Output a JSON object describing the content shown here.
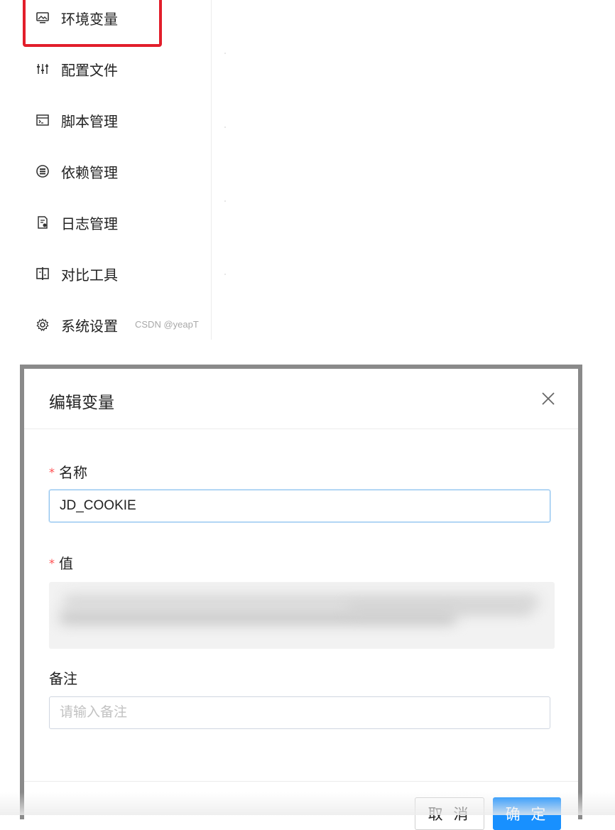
{
  "sidebar": {
    "items": [
      {
        "label": "环境变量",
        "icon": "monitor-icon"
      },
      {
        "label": "配置文件",
        "icon": "sliders-icon"
      },
      {
        "label": "脚本管理",
        "icon": "script-icon"
      },
      {
        "label": "依赖管理",
        "icon": "database-icon"
      },
      {
        "label": "日志管理",
        "icon": "log-icon"
      },
      {
        "label": "对比工具",
        "icon": "diff-icon"
      },
      {
        "label": "系统设置",
        "icon": "gear-icon"
      }
    ],
    "highlight_color": "#e21e2b"
  },
  "watermark": "CSDN @yeapT",
  "modal": {
    "title": "编辑变量",
    "close_icon": "close-icon",
    "fields": {
      "name": {
        "label": "名称",
        "required_mark": "*",
        "value": "JD_COOKIE"
      },
      "value": {
        "label": "值",
        "required_mark": "*"
      },
      "remark": {
        "label": "备注",
        "placeholder": "请输入备注"
      }
    },
    "buttons": {
      "cancel": "取 消",
      "ok": "确 定"
    },
    "accent_color": "#1890ff"
  }
}
